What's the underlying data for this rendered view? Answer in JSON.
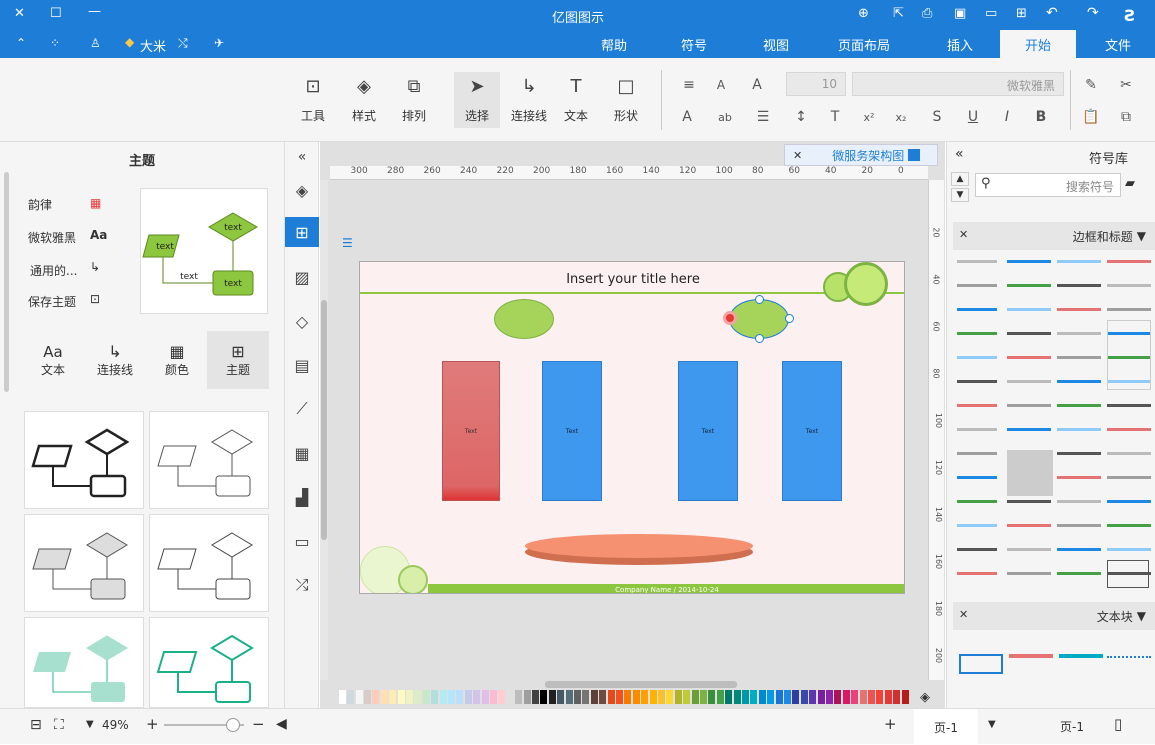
{
  "app_title": "亿图图示",
  "tabs": [
    {
      "label": "文件",
      "active": false
    },
    {
      "label": "开始",
      "active": true
    },
    {
      "label": "插入",
      "active": false
    },
    {
      "label": "页面布局",
      "active": false
    },
    {
      "label": "视图",
      "active": false
    },
    {
      "label": "符号",
      "active": false
    },
    {
      "label": "帮助",
      "active": false
    }
  ],
  "user_name": "大米",
  "ribbon": {
    "font_name": "微软雅黑",
    "font_size": "10",
    "buttons": {
      "select": "选择",
      "shape": "形状",
      "text": "文本",
      "connector": "连接线",
      "arrange": "排列",
      "style": "样式",
      "tools": "工具"
    }
  },
  "left_panel": {
    "title": "主题",
    "options": [
      "韵律",
      "微软雅黑",
      "通用的...",
      "保存主题"
    ],
    "tabs": [
      "主题",
      "颜色",
      "连接线",
      "文本"
    ],
    "preview_labels": [
      "text",
      "text",
      "text",
      "text"
    ]
  },
  "document_tab": "微服务架构图",
  "ruler_labels": [
    "0",
    "20",
    "40",
    "60",
    "80",
    "100",
    "120",
    "140",
    "160",
    "180",
    "200",
    "220",
    "240",
    "260",
    "280",
    "300"
  ],
  "vruler_labels": [
    "20",
    "40",
    "60",
    "80",
    "100",
    "120",
    "140",
    "160",
    "180",
    "200"
  ],
  "canvas": {
    "title": "Insert your title here",
    "box_labels": [
      "Text",
      "Text",
      "Text",
      "Text"
    ],
    "footer": "Company Name / 2014-10-24"
  },
  "right_panel": {
    "title": "符号库",
    "search_placeholder": "搜索符号",
    "section1": "边框和标题",
    "section2": "文本块"
  },
  "statusbar": {
    "page_dropdown": "页-1",
    "page_tab": "页-1",
    "zoom": "49%"
  },
  "colors": {
    "brand": "#1e7ed7",
    "canvas_bg": "#fdf0f0",
    "green": "#8dc63f",
    "blue_box": "#3d98ee",
    "red_box": "#e07b7b",
    "orange": "#f59070"
  },
  "palette": [
    "#b71c1c",
    "#d32f2f",
    "#e53935",
    "#f44336",
    "#ef5350",
    "#e57373",
    "#ec407a",
    "#d81b60",
    "#ad1457",
    "#8e24aa",
    "#7b1fa2",
    "#5e35b1",
    "#3949ab",
    "#303f9f",
    "#1e88e5",
    "#1976d2",
    "#039be5",
    "#0288d1",
    "#00acc1",
    "#0097a7",
    "#00897b",
    "#00796b",
    "#43a047",
    "#388e3c",
    "#7cb342",
    "#689f38",
    "#c0ca33",
    "#afb42b",
    "#fdd835",
    "#fbc02d",
    "#ffb300",
    "#ffa000",
    "#fb8c00",
    "#f57c00",
    "#f4511e",
    "#e64a19",
    "#6d4c41",
    "#5d4037",
    "#757575",
    "#616161",
    "#546e7a",
    "#455a64",
    "#212121",
    "#000000",
    "#424242",
    "#9e9e9e",
    "#bdbdbd",
    "#e0e0e0",
    "#ffcdd2",
    "#f8bbd0",
    "#e1bee7",
    "#d1c4e9",
    "#c5cae9",
    "#bbdefb",
    "#b3e5fc",
    "#b2ebf2",
    "#b2dfdb",
    "#c8e6c9",
    "#dcedc8",
    "#f0f4c3",
    "#fff9c4",
    "#ffecb3",
    "#ffe0b2",
    "#ffccbc",
    "#d7ccc8",
    "#f5f5f5",
    "#cfd8dc",
    "#ffffff"
  ]
}
